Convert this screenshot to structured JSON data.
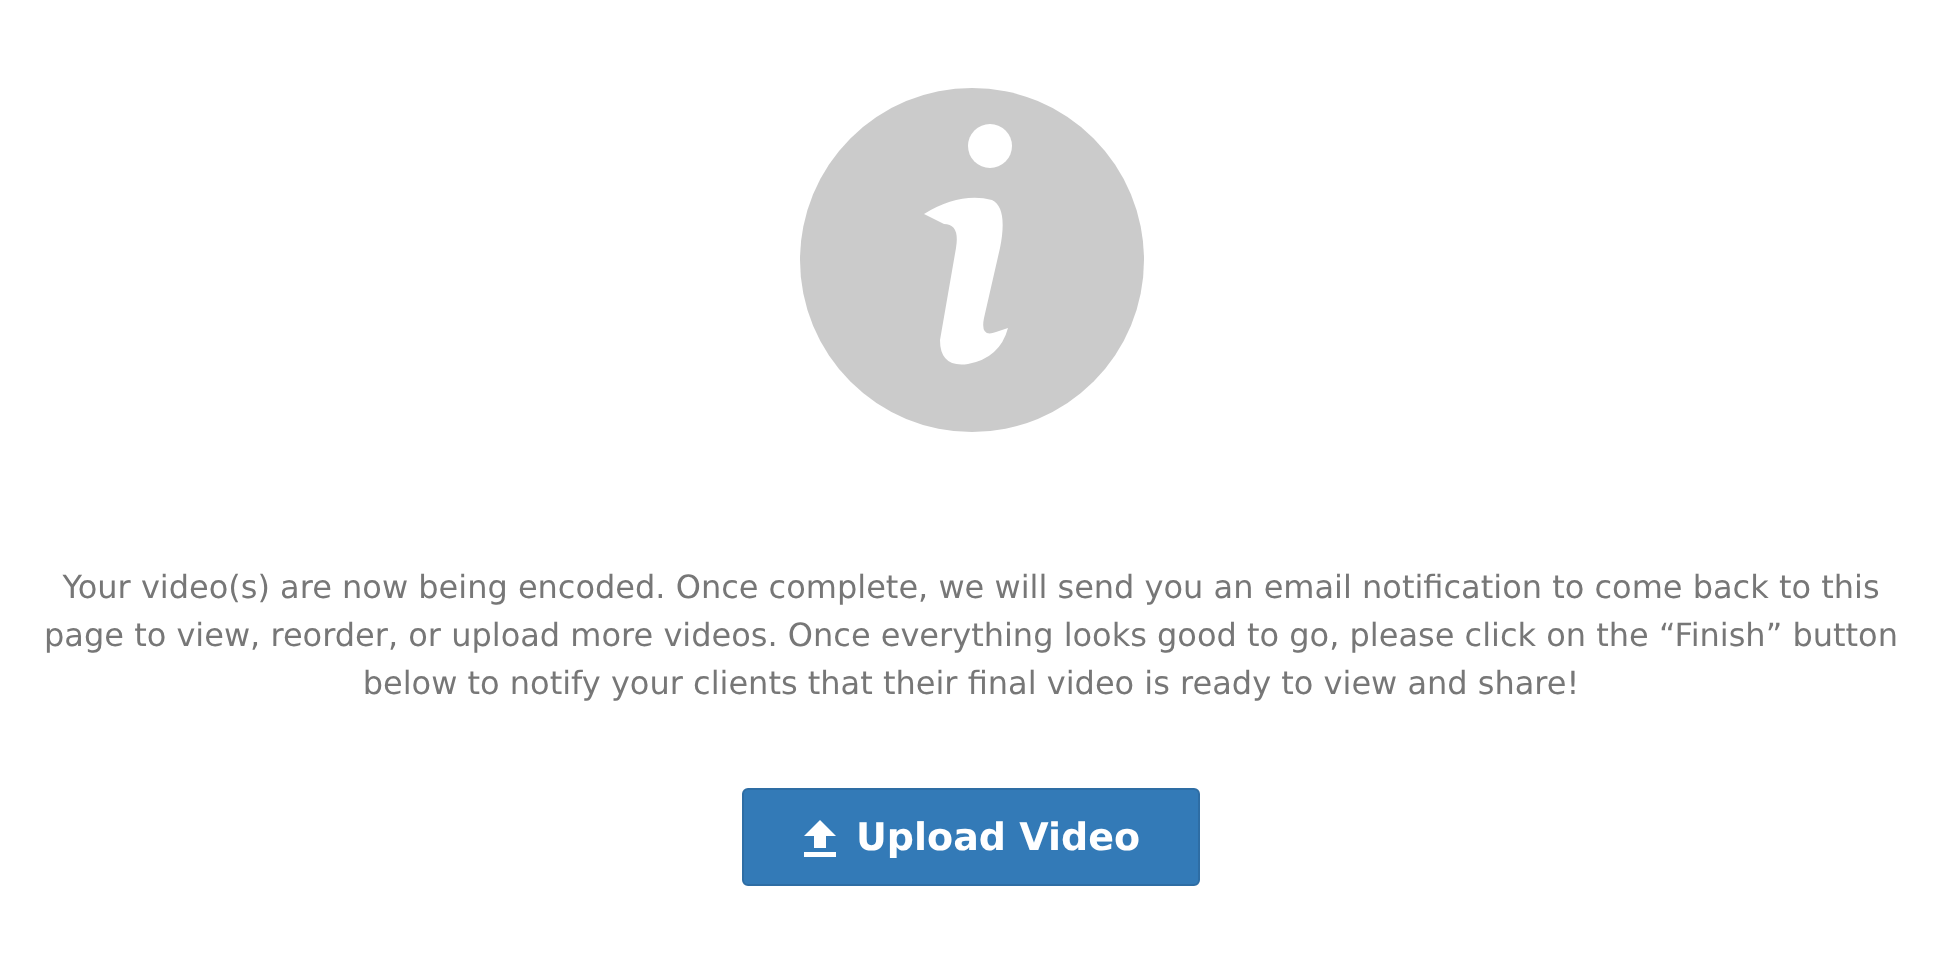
{
  "message": "Your video(s) are now being encoded. Once complete, we will send you an email notification to come back to this page to view, reorder, or upload more videos. Once everything looks good to go, please click on the “Finish” button below to notify your clients that their final video is ready to view and share!",
  "button": {
    "label": "Upload Video"
  }
}
